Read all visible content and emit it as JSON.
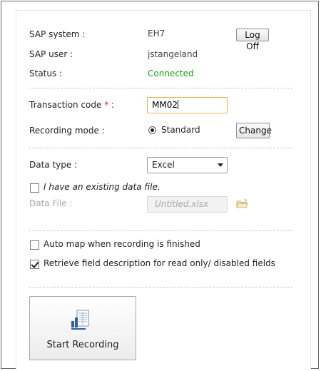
{
  "session": {
    "system_label": "SAP system :",
    "system_value": "EH7",
    "logoff_label": "Log Off",
    "user_label": "SAP user :",
    "user_value": "jstangeland",
    "status_label": "Status :",
    "status_value": "Connected"
  },
  "recording": {
    "tcode_label": "Transaction code",
    "required_marker": "*",
    "label_suffix": " :",
    "tcode_value": "MM02",
    "mode_label": "Recording mode :",
    "mode_value": "Standard",
    "change_label": "Change"
  },
  "data": {
    "type_label": "Data type :",
    "type_selected": "Excel",
    "existing_file_label": "I have an existing data file.",
    "existing_file_checked": false,
    "file_label": "Data File :",
    "file_placeholder": "Untitled.xlsx"
  },
  "options": {
    "automap_label": "Auto map when recording is finished",
    "automap_checked": false,
    "retrieve_label": "Retrieve field description for read only/ disabled fields",
    "retrieve_checked": true
  },
  "actions": {
    "start_label": "Start Recording"
  },
  "colors": {
    "status_connected": "#1aa31a",
    "required_marker": "#d9261c",
    "input_focus_border": "#e6b34a",
    "icon_blue": "#2b5fa8"
  },
  "icons": {
    "open_file": "folder-open-icon",
    "start_recording": "spreadsheet-record-icon"
  }
}
